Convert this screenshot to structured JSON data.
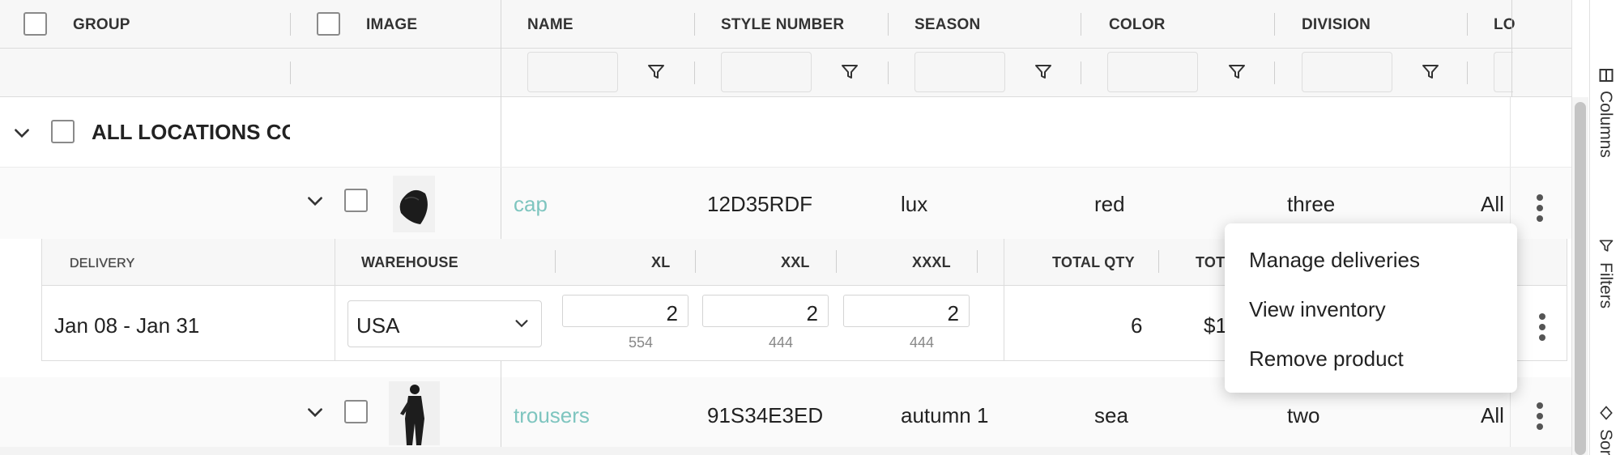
{
  "header": {
    "group": "GROUP",
    "image": "IMAGE",
    "name": "NAME",
    "style_number": "STYLE NUMBER",
    "season": "SEASON",
    "color": "COLOR",
    "division": "DIVISION",
    "lo": "LO"
  },
  "group_row": {
    "label": "ALL LOCATIONS COI"
  },
  "products": [
    {
      "name": "cap",
      "style": "12D35RDF",
      "season": "lux",
      "color": "red",
      "division": "three",
      "location": "All"
    },
    {
      "name": "trousers",
      "style": "91S34E3ED",
      "season": "autumn 1",
      "color": "sea",
      "division": "two",
      "location": "All"
    }
  ],
  "delivery": {
    "headers": {
      "delivery": "DELIVERY",
      "warehouse": "WAREHOUSE",
      "xl": "XL",
      "xxl": "XXL",
      "xxxl": "XXXL",
      "total_qty": "TOTAL QTY",
      "total": "TOT"
    },
    "row": {
      "dates": "Jan 08 - Jan 31",
      "warehouse": "USA",
      "xl": "2",
      "xl_stock": "554",
      "xxl": "2",
      "xxl_stock": "444",
      "xxxl": "2",
      "xxxl_stock": "444",
      "total_qty": "6",
      "total": "$1"
    }
  },
  "context_menu": {
    "items": [
      "Manage deliveries",
      "View inventory",
      "Remove product"
    ]
  },
  "side_panel": {
    "columns": "Columns",
    "filters": "Filters",
    "sort": "Sort"
  },
  "colors": {
    "accent": "#7ec5bf",
    "header_bg": "#f7f7f7"
  },
  "icons": {
    "filter": "filter-icon",
    "chevron": "chevron-down-icon",
    "kebab": "kebab-icon"
  }
}
